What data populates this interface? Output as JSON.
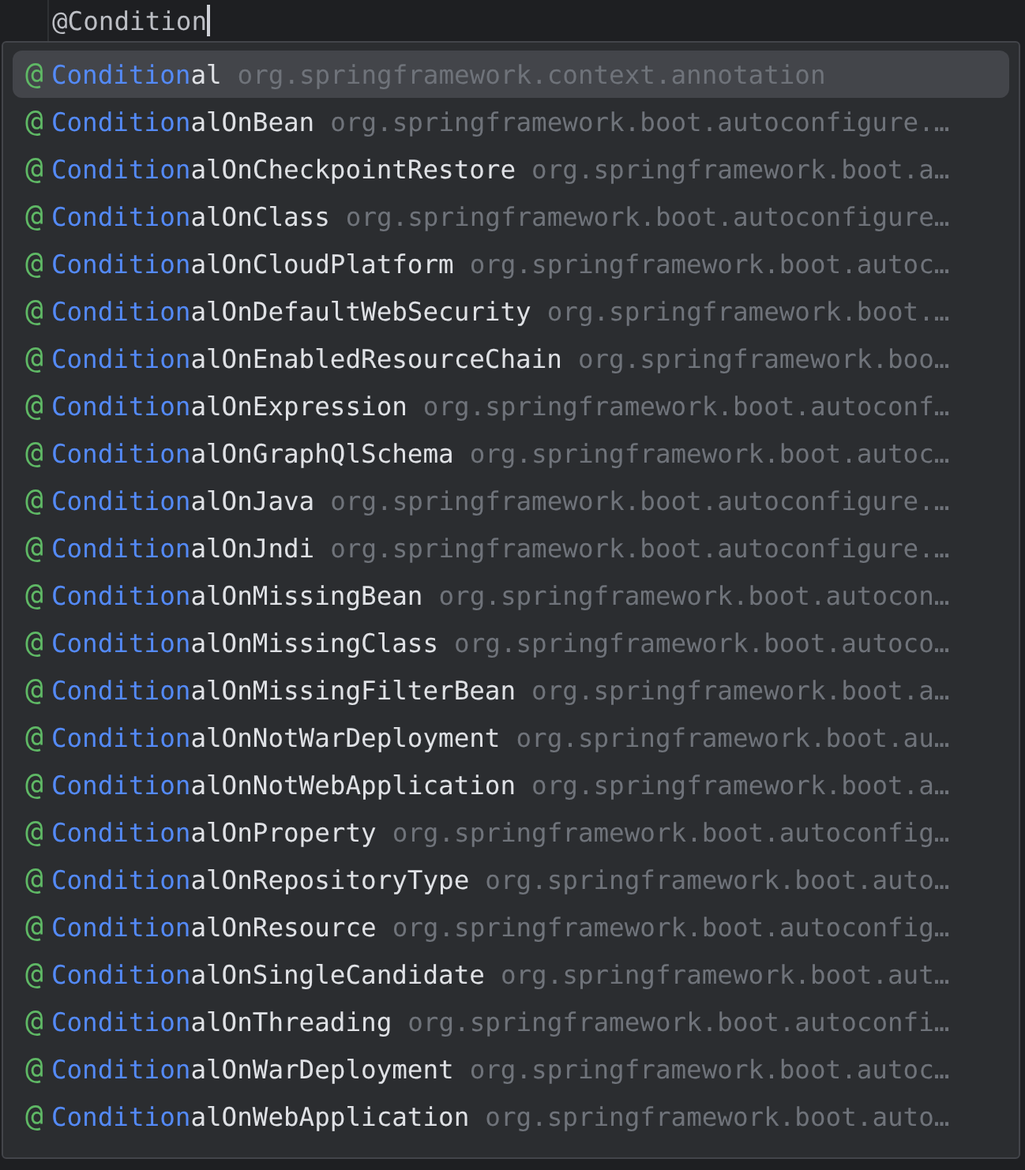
{
  "editor": {
    "line_text": "@Condition"
  },
  "completion_popup": {
    "items": [
      {
        "icon": "@",
        "match": "Condition",
        "rest": "al",
        "package": "org.springframework.context.annotation",
        "selected": true
      },
      {
        "icon": "@",
        "match": "Condition",
        "rest": "alOnBean",
        "package": "org.springframework.boot.autoconfigure.…",
        "selected": false
      },
      {
        "icon": "@",
        "match": "Condition",
        "rest": "alOnCheckpointRestore",
        "package": "org.springframework.boot.a…",
        "selected": false
      },
      {
        "icon": "@",
        "match": "Condition",
        "rest": "alOnClass",
        "package": "org.springframework.boot.autoconfigure…",
        "selected": false
      },
      {
        "icon": "@",
        "match": "Condition",
        "rest": "alOnCloudPlatform",
        "package": "org.springframework.boot.autoc…",
        "selected": false
      },
      {
        "icon": "@",
        "match": "Condition",
        "rest": "alOnDefaultWebSecurity",
        "package": "org.springframework.boot.…",
        "selected": false
      },
      {
        "icon": "@",
        "match": "Condition",
        "rest": "alOnEnabledResourceChain",
        "package": "org.springframework.boo…",
        "selected": false
      },
      {
        "icon": "@",
        "match": "Condition",
        "rest": "alOnExpression",
        "package": "org.springframework.boot.autoconf…",
        "selected": false
      },
      {
        "icon": "@",
        "match": "Condition",
        "rest": "alOnGraphQlSchema",
        "package": "org.springframework.boot.autoc…",
        "selected": false
      },
      {
        "icon": "@",
        "match": "Condition",
        "rest": "alOnJava",
        "package": "org.springframework.boot.autoconfigure.…",
        "selected": false
      },
      {
        "icon": "@",
        "match": "Condition",
        "rest": "alOnJndi",
        "package": "org.springframework.boot.autoconfigure.…",
        "selected": false
      },
      {
        "icon": "@",
        "match": "Condition",
        "rest": "alOnMissingBean",
        "package": "org.springframework.boot.autocon…",
        "selected": false
      },
      {
        "icon": "@",
        "match": "Condition",
        "rest": "alOnMissingClass",
        "package": "org.springframework.boot.autoco…",
        "selected": false
      },
      {
        "icon": "@",
        "match": "Condition",
        "rest": "alOnMissingFilterBean",
        "package": "org.springframework.boot.a…",
        "selected": false
      },
      {
        "icon": "@",
        "match": "Condition",
        "rest": "alOnNotWarDeployment",
        "package": "org.springframework.boot.au…",
        "selected": false
      },
      {
        "icon": "@",
        "match": "Condition",
        "rest": "alOnNotWebApplication",
        "package": "org.springframework.boot.a…",
        "selected": false
      },
      {
        "icon": "@",
        "match": "Condition",
        "rest": "alOnProperty",
        "package": "org.springframework.boot.autoconfig…",
        "selected": false
      },
      {
        "icon": "@",
        "match": "Condition",
        "rest": "alOnRepositoryType",
        "package": "org.springframework.boot.auto…",
        "selected": false
      },
      {
        "icon": "@",
        "match": "Condition",
        "rest": "alOnResource",
        "package": "org.springframework.boot.autoconfig…",
        "selected": false
      },
      {
        "icon": "@",
        "match": "Condition",
        "rest": "alOnSingleCandidate",
        "package": "org.springframework.boot.aut…",
        "selected": false
      },
      {
        "icon": "@",
        "match": "Condition",
        "rest": "alOnThreading",
        "package": "org.springframework.boot.autoconfi…",
        "selected": false
      },
      {
        "icon": "@",
        "match": "Condition",
        "rest": "alOnWarDeployment",
        "package": "org.springframework.boot.autoc…",
        "selected": false
      },
      {
        "icon": "@",
        "match": "Condition",
        "rest": "alOnWebApplication",
        "package": "org.springframework.boot.auto…",
        "selected": false
      }
    ]
  }
}
